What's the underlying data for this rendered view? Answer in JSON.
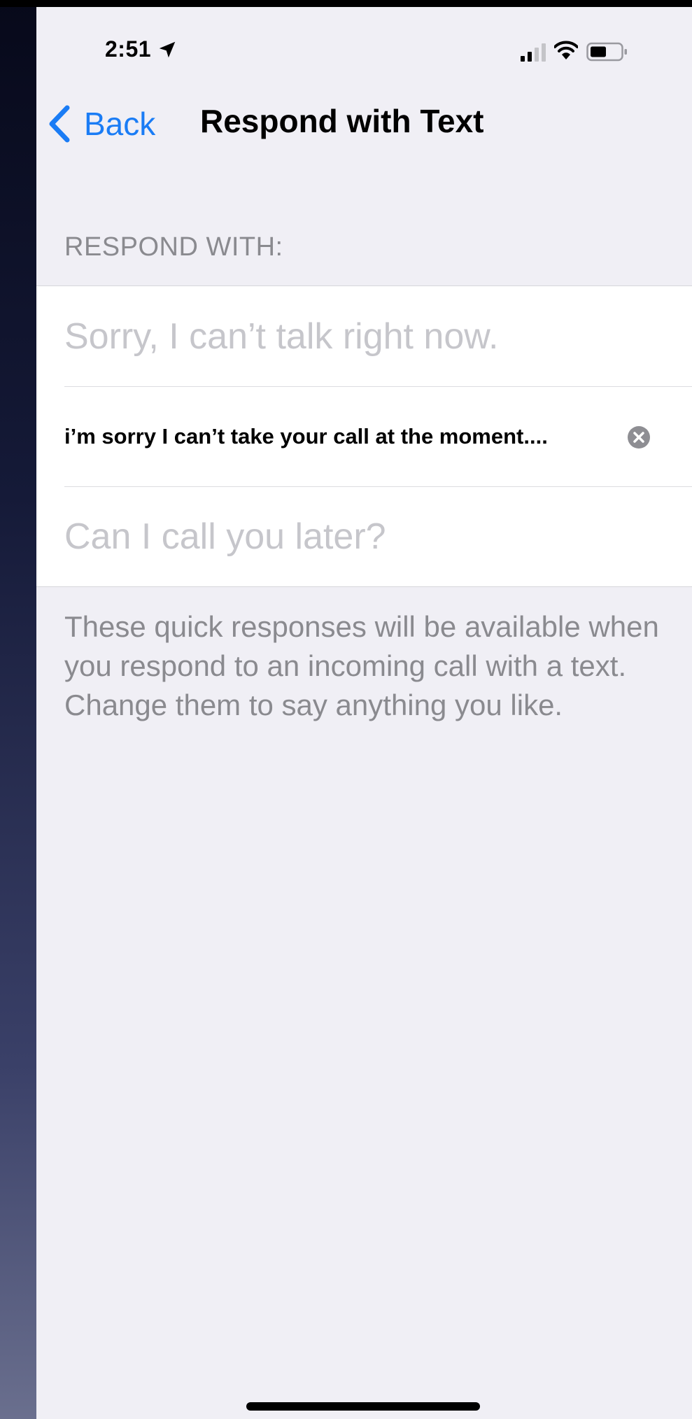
{
  "status_bar": {
    "time": "2:51",
    "location_icon": "location-arrow-icon",
    "signal_icon": "cellular-signal-icon",
    "wifi_icon": "wifi-icon",
    "battery_icon": "battery-icon"
  },
  "nav": {
    "back_label": "Back",
    "title": "Respond with Text"
  },
  "section": {
    "header": "RESPOND WITH:",
    "responses": [
      {
        "placeholder": "Sorry, I can’t talk right now.",
        "value": ""
      },
      {
        "placeholder": "",
        "value": "i’m sorry I can’t take your call at the moment...."
      },
      {
        "placeholder": "Can I call you later?",
        "value": ""
      }
    ],
    "footer": "These quick responses will be available when you respond to an incoming call with a text. Change them to say anything you like."
  },
  "colors": {
    "accent": "#1a7cf5",
    "background": "#f0eff5",
    "secondary_text": "#8a8a8f",
    "placeholder_text": "#c6c6cb"
  }
}
